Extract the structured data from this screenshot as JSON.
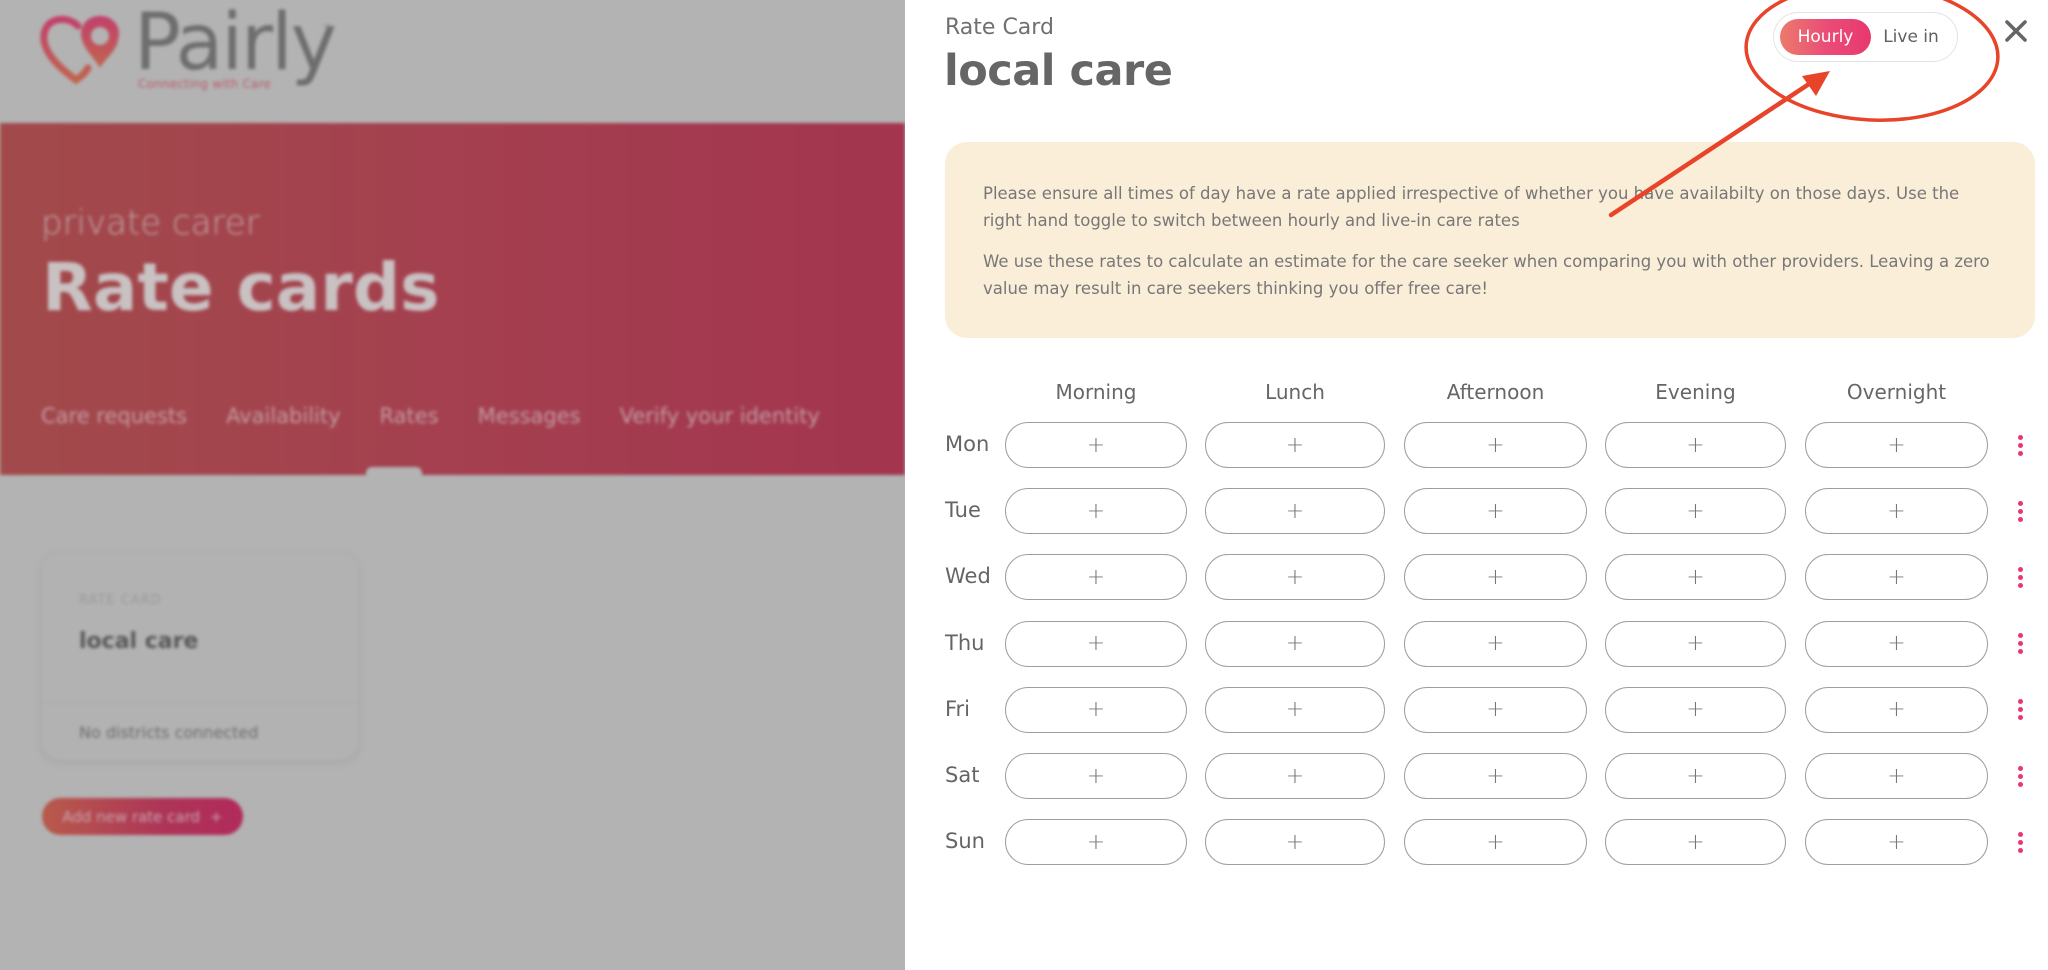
{
  "background": {
    "brand": {
      "name": "Pairly",
      "trademark": "™",
      "tagline": "Connecting with Care"
    },
    "hero": {
      "subtitle": "private carer",
      "title": "Rate cards",
      "nav": [
        {
          "label": "Care requests",
          "active": false
        },
        {
          "label": "Availability",
          "active": false
        },
        {
          "label": "Rates",
          "active": true
        },
        {
          "label": "Messages",
          "active": false
        },
        {
          "label": "Verify your identity",
          "active": false
        }
      ]
    },
    "rate_card": {
      "label": "RATE CARD",
      "name": "local care",
      "footer": "No districts connected"
    },
    "add_button": {
      "label": "Add new rate card",
      "icon": "+"
    }
  },
  "panel": {
    "kicker": "Rate Card",
    "title": "local care",
    "toggle": {
      "options": [
        {
          "label": "Hourly",
          "selected": true
        },
        {
          "label": "Live in",
          "selected": false
        }
      ]
    },
    "close_icon": "close-icon",
    "info": {
      "paragraphs": [
        "Please ensure all times of day have a rate applied irrespective of whether you have availabilty on those days. Use the right hand toggle to switch between hourly and live-in care rates",
        "We use these rates to calculate an estimate for the care seeker when comparing you with other providers. Leaving a zero value may result in care seekers thinking you offer free care!"
      ]
    },
    "grid": {
      "columns": [
        "Morning",
        "Lunch",
        "Afternoon",
        "Evening",
        "Overnight"
      ],
      "rows": [
        {
          "day": "Mon",
          "slots": [
            "+",
            "+",
            "+",
            "+",
            "+"
          ]
        },
        {
          "day": "Tue",
          "slots": [
            "+",
            "+",
            "+",
            "+",
            "+"
          ]
        },
        {
          "day": "Wed",
          "slots": [
            "+",
            "+",
            "+",
            "+",
            "+"
          ]
        },
        {
          "day": "Thu",
          "slots": [
            "+",
            "+",
            "+",
            "+",
            "+"
          ]
        },
        {
          "day": "Fri",
          "slots": [
            "+",
            "+",
            "+",
            "+",
            "+"
          ]
        },
        {
          "day": "Sat",
          "slots": [
            "+",
            "+",
            "+",
            "+",
            "+"
          ]
        },
        {
          "day": "Sun",
          "slots": [
            "+",
            "+",
            "+",
            "+",
            "+"
          ]
        }
      ],
      "row_menu_icon": "more-vertical-icon"
    }
  },
  "colors": {
    "accent": "#e8386e",
    "accent_gradient_start": "#ec7a6c",
    "info_bg": "#fbeed8",
    "annotation": "#e8442a",
    "overlay_gray": "#b3b3b3"
  }
}
